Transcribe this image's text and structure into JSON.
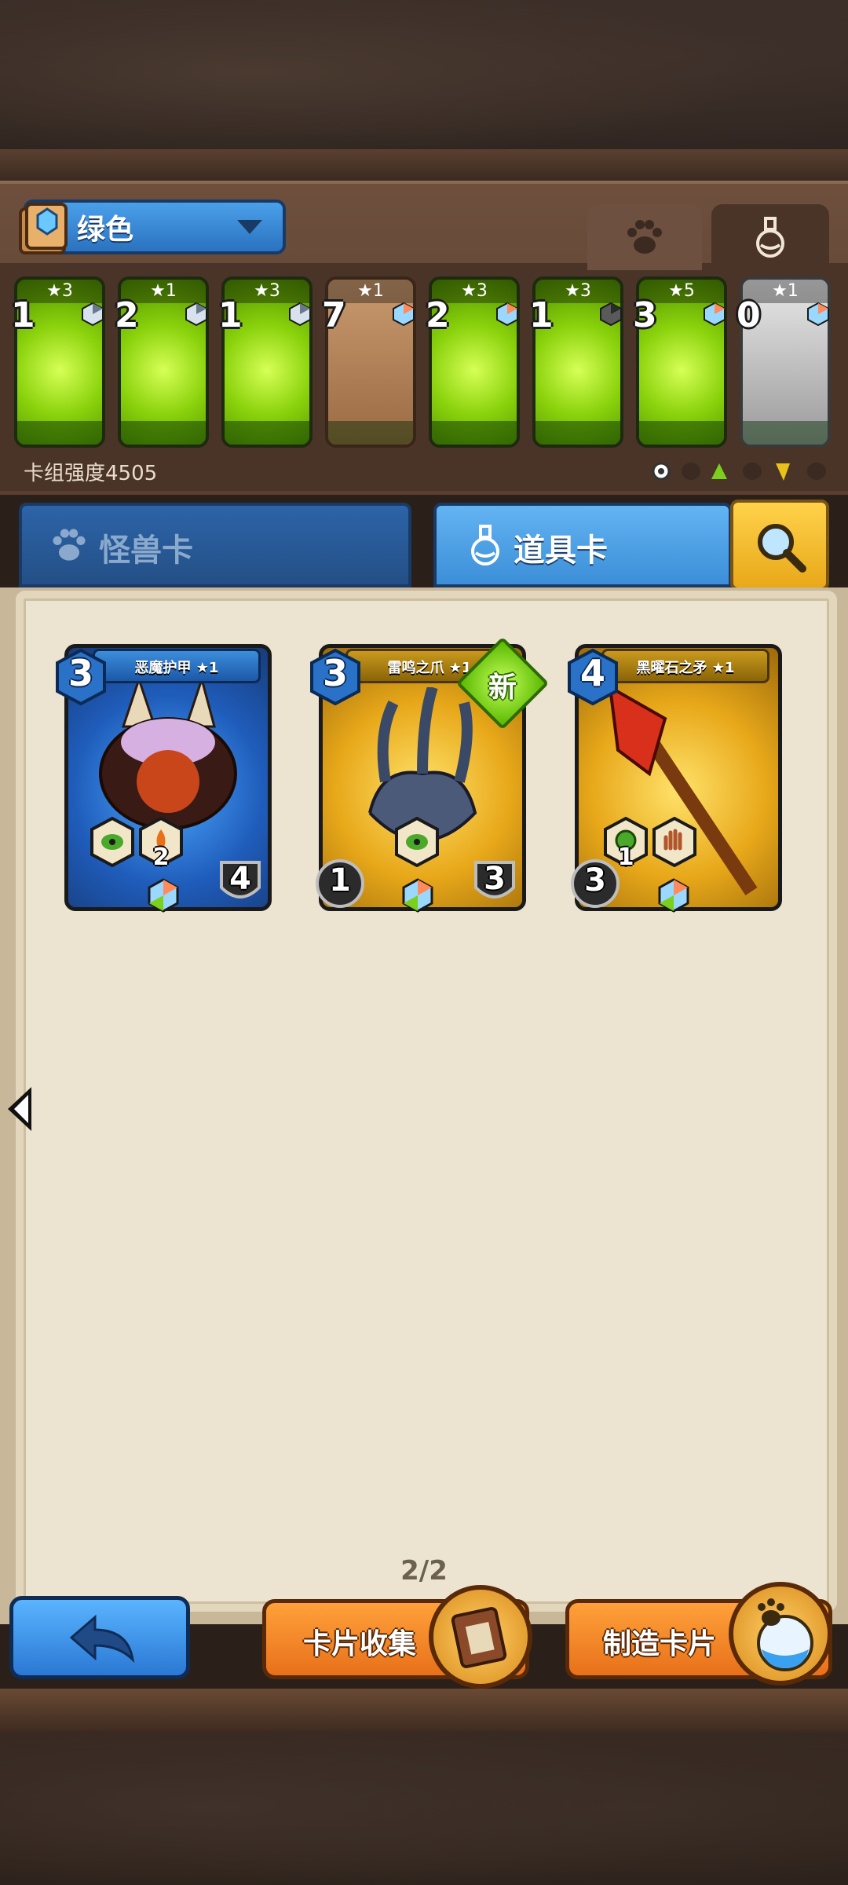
{
  "deck": {
    "name": "绿色",
    "power_label": "卡组强度4505",
    "cards": [
      {
        "stars": "★3",
        "cost": "1",
        "style": "green",
        "gem": "silver"
      },
      {
        "stars": "★1",
        "cost": "2",
        "style": "green",
        "gem": "silver"
      },
      {
        "stars": "★3",
        "cost": "1",
        "style": "green",
        "gem": "silver"
      },
      {
        "stars": "★1",
        "cost": "7",
        "style": "brown",
        "gem": "rainbow"
      },
      {
        "stars": "★3",
        "cost": "2",
        "style": "green",
        "gem": "rainbow"
      },
      {
        "stars": "★3",
        "cost": "1",
        "style": "green",
        "gem": "dark"
      },
      {
        "stars": "★5",
        "cost": "3",
        "style": "green",
        "gem": "rainbow"
      },
      {
        "stars": "★1",
        "cost": "0",
        "style": "silver",
        "gem": "rainbow"
      }
    ]
  },
  "category_tabs": [
    "paw-icon",
    "potion-icon"
  ],
  "type_tabs": {
    "monster": "怪兽卡",
    "item": "道具卡"
  },
  "collection": {
    "cards": [
      {
        "name": "恶魔护甲 ★1",
        "cost": "3",
        "stat_left": "",
        "stat_right": "4",
        "ability_count": "2",
        "style": "blue",
        "is_new": false
      },
      {
        "name": "雷鸣之爪 ★1",
        "cost": "3",
        "stat_left": "1",
        "stat_right": "3",
        "ability_count": "",
        "style": "gold",
        "is_new": true
      },
      {
        "name": "黑曜石之矛 ★1",
        "cost": "4",
        "stat_left": "3",
        "stat_right": "",
        "ability_count": "1",
        "style": "gold",
        "is_new": false
      }
    ],
    "new_badge": "新",
    "page": "2/2"
  },
  "buttons": {
    "collection": "卡片收集",
    "craft": "制造卡片"
  },
  "colors": {
    "accent_blue": "#2a78d4",
    "accent_orange": "#e8701a",
    "card_green": "#8ad20c"
  }
}
